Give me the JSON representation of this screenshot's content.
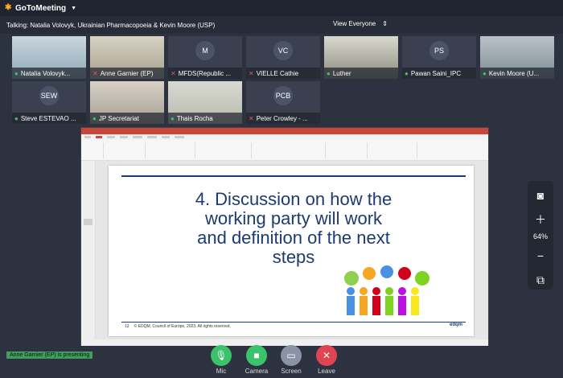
{
  "app": {
    "name": "GoToMeeting"
  },
  "talking": {
    "text": "Talking: Natalia Volovyk, Ukrainian Pharmacopoeia & Kevin Moore (USP)",
    "view_label": "View Everyone"
  },
  "participants": [
    {
      "name": "Natalia Volovyk...",
      "initials": "",
      "mic": "on"
    },
    {
      "name": "Anne Garnier (EP)",
      "initials": "",
      "mic": "off"
    },
    {
      "name": "MFDS(Republic ...",
      "initials": "M",
      "mic": "off"
    },
    {
      "name": "VIELLE Cathie",
      "initials": "VC",
      "mic": "off"
    },
    {
      "name": "Luther",
      "initials": "",
      "mic": "on"
    },
    {
      "name": "Pawan Saini_IPC",
      "initials": "PS",
      "mic": "on"
    },
    {
      "name": "Kevin Moore (U...",
      "initials": "",
      "mic": "on"
    },
    {
      "name": "Steve ESTEVAO ...",
      "initials": "SEW",
      "mic": "on"
    },
    {
      "name": "JP Secretariat",
      "initials": "",
      "mic": "on"
    },
    {
      "name": "Thais Rocha",
      "initials": "",
      "mic": "on"
    },
    {
      "name": "Peter Crowley - ...",
      "initials": "PCB",
      "mic": "off"
    }
  ],
  "slide": {
    "heading_lines": [
      "4. Discussion on how the",
      "working party will work",
      "and definition of the next",
      "steps"
    ],
    "footer_number": "12",
    "footer_text": "© EDQM, Council of Europe, 2023. All rights reserved.",
    "logo_text": "edqm"
  },
  "tools": {
    "zoom": "64%"
  },
  "status": {
    "presenting": "Anne Garnier (EP) is presenting"
  },
  "controls": {
    "mic": "Mic",
    "camera": "Camera",
    "screen": "Screen",
    "leave": "Leave"
  },
  "colors": {
    "mic_on": "#3bc36b",
    "mic_off": "#e05566",
    "leave": "#e04452",
    "presenting_bg": "#3f9e5b",
    "slide_blue": "#1c3b70"
  }
}
